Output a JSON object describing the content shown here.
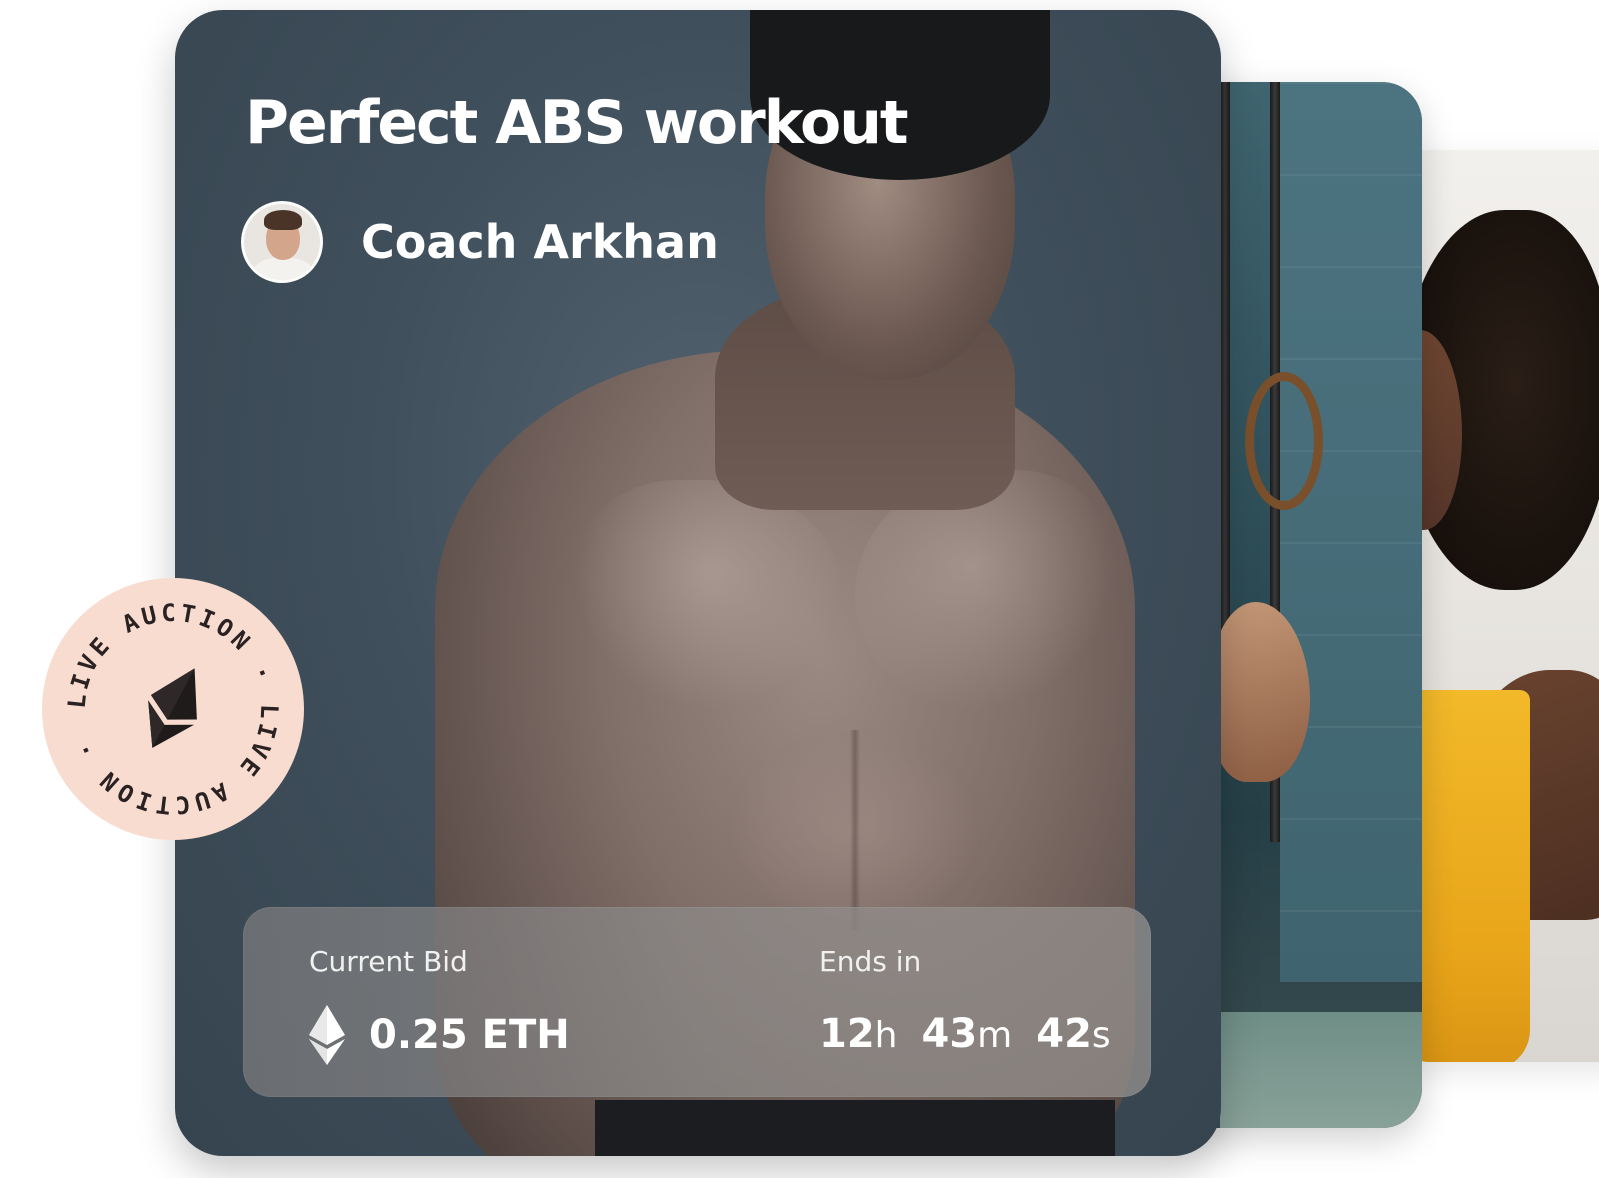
{
  "card": {
    "title": "Perfect ABS workout",
    "coach_name": "Coach Arkhan",
    "current_bid_label": "Current Bid",
    "current_bid_value": "0.25 ETH",
    "ends_in_label": "Ends in",
    "countdown": [
      {
        "num": "12",
        "unit": "h"
      },
      {
        "num": "43",
        "unit": "m"
      },
      {
        "num": "42",
        "unit": "s"
      }
    ]
  },
  "badge": {
    "ring_text": "LIVE AUCTION · LIVE AUCTION · ",
    "icon": "ethereum-icon",
    "color": "#f8dcd0"
  },
  "icons": {
    "bid_currency": "ethereum-icon"
  }
}
